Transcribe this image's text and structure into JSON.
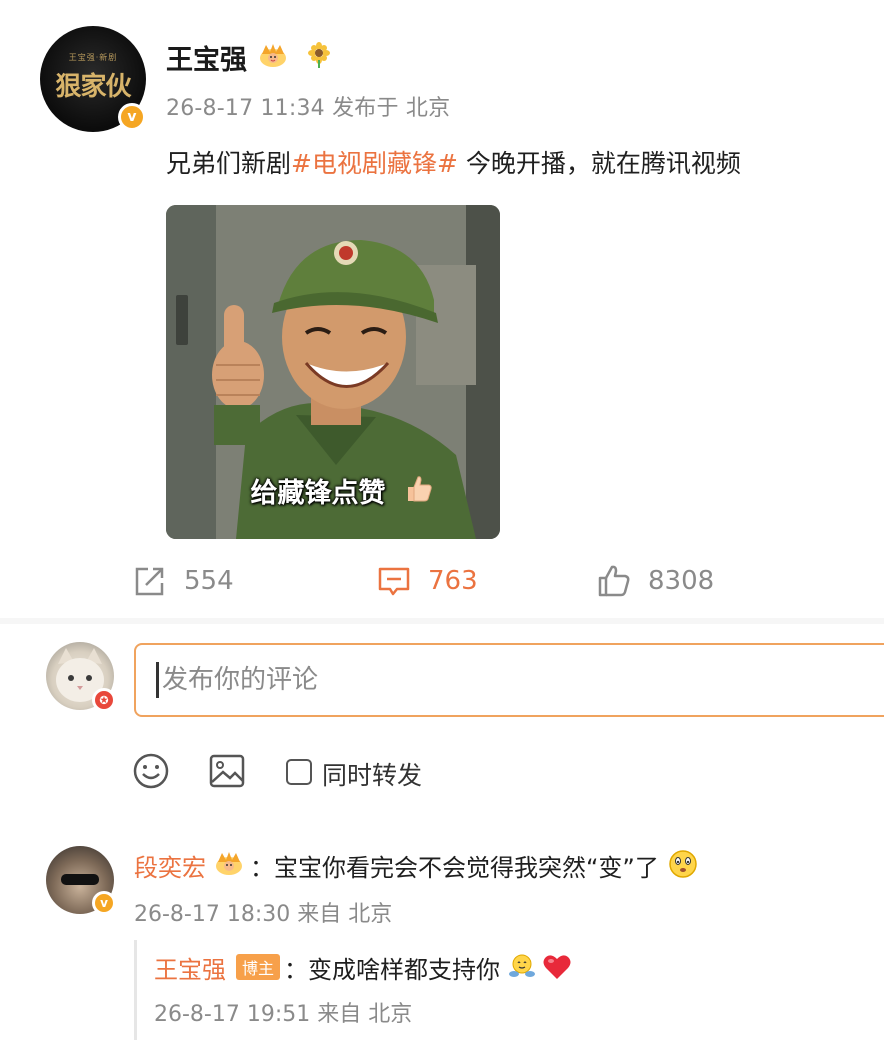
{
  "post": {
    "avatar_logo_small": "王宝强·新剧",
    "avatar_logo_main": "狠家伙",
    "author": "王宝强",
    "timestamp": "26-8-17 11:34",
    "location_prefix": "发布于",
    "location": "北京",
    "text_before": "兄弟们新剧",
    "hashtag": "#电视剧藏锋#",
    "text_after": " 今晚开播，就在腾讯视频",
    "image_caption": "给藏锋点赞",
    "icons": {
      "verified": "verified-badge-icon",
      "crown": "crown-icon",
      "sunflower": "sunflower-icon"
    }
  },
  "actions": {
    "repost_count": "554",
    "comment_count": "763",
    "like_count": "8308",
    "active_color": "#eb7340"
  },
  "compose": {
    "placeholder": "发布你的评论",
    "repost_option_label": "同时转发"
  },
  "comments": [
    {
      "author": "段奕宏",
      "separator": "：",
      "text": "宝宝你看完会不会觉得我突然“变”了",
      "timestamp": "26-8-17 18:30",
      "source_prefix": "来自",
      "location": "北京",
      "reply": {
        "author": "王宝强",
        "tag": "博主",
        "separator": "：",
        "text": "变成啥样都支持你",
        "timestamp": "26-8-17 19:51",
        "source_prefix": "来自",
        "location": "北京"
      }
    }
  ],
  "colors": {
    "accent": "#eb7340",
    "input_border": "#f0a35e",
    "verified": "#f5a623",
    "tag_bg": "#f7a04a",
    "muted_text": "#8a8a8a"
  }
}
